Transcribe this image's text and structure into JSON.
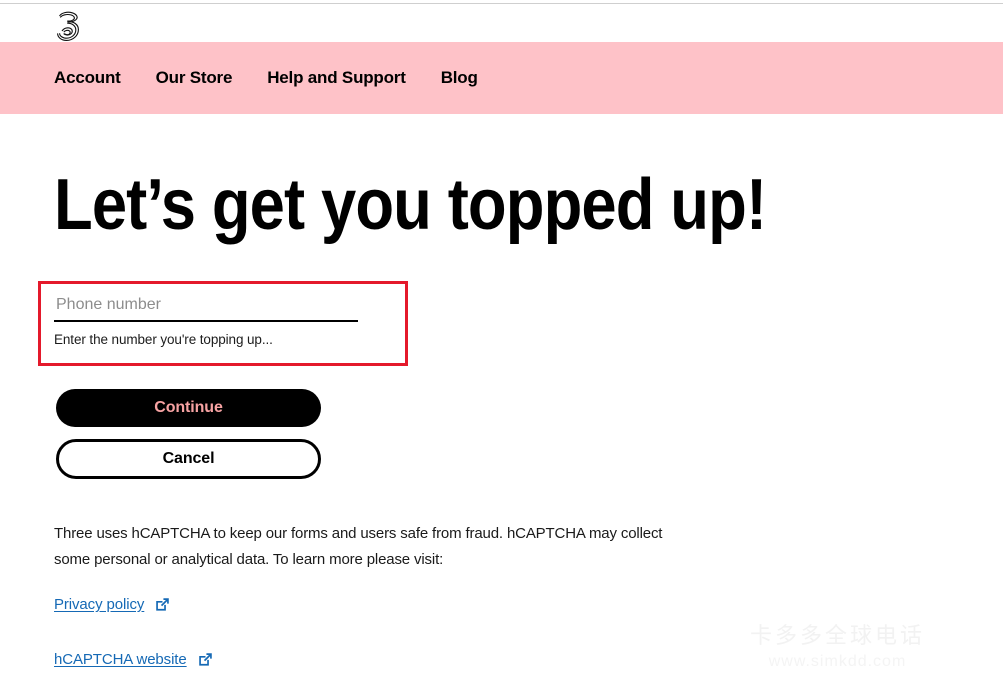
{
  "brand": {
    "logo_name": "three-logo",
    "logo_alt": "3"
  },
  "nav": {
    "items": [
      {
        "label": "Account",
        "name": "nav-item-account"
      },
      {
        "label": "Our Store",
        "name": "nav-item-our-store"
      },
      {
        "label": "Help and Support",
        "name": "nav-item-help-and-support"
      },
      {
        "label": "Blog",
        "name": "nav-item-blog"
      }
    ],
    "background_color": "#fec2c8"
  },
  "main": {
    "headline": "Let’s get you topped up!",
    "form": {
      "phone_input": {
        "placeholder": "Phone number",
        "value": "",
        "help_text": "Enter the number you're topping up..."
      },
      "highlight_color": "#e4192b"
    },
    "buttons": {
      "continue_label": "Continue",
      "continue_bg": "#000000",
      "continue_color": "#f7a3a3",
      "cancel_label": "Cancel",
      "cancel_bg": "#ffffff",
      "cancel_color": "#000000"
    },
    "notice": "Three uses hCAPTCHA to keep our forms and users safe from fraud. hCAPTCHA may collect some personal or analytical data. To learn more please visit:",
    "links": [
      {
        "label": "Privacy policy",
        "name": "privacy-policy-link",
        "icon": "external-link-icon"
      },
      {
        "label": "hCAPTCHA website",
        "name": "hcaptcha-website-link",
        "icon": "external-link-icon"
      }
    ],
    "link_color": "#1569b5"
  },
  "watermark": {
    "line1": "卡多多全球电话",
    "line2": "www.simkdd.com"
  }
}
